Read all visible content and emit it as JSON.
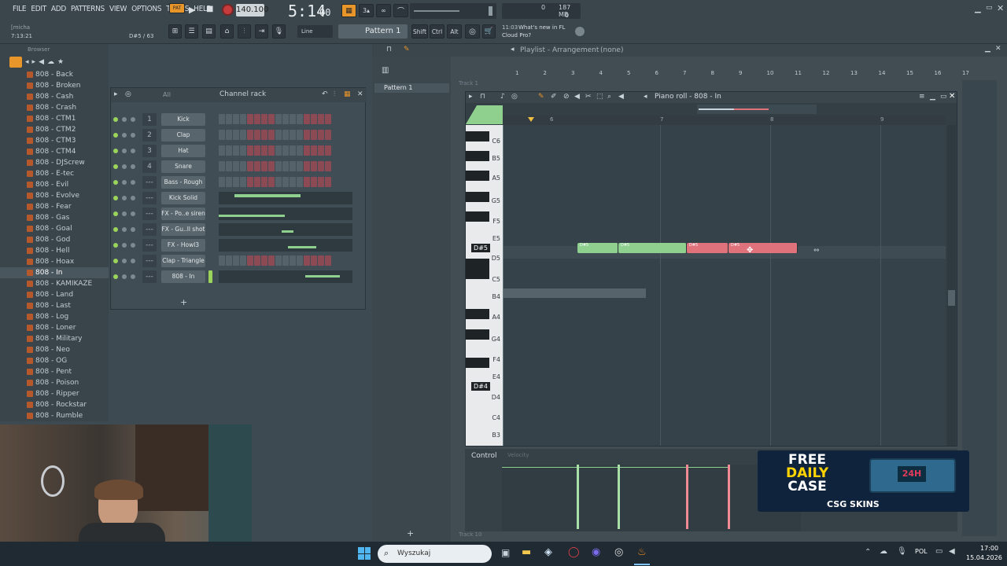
{
  "menu": [
    "FILE",
    "EDIT",
    "ADD",
    "PATTERNS",
    "VIEW",
    "OPTIONS",
    "TOOLS",
    "HELP"
  ],
  "transport": {
    "pat_label": "PAT",
    "tempo": "140.100",
    "time": "5:14",
    "time_ms": "00",
    "time_small": "M:S:CS",
    "cpu": "0",
    "mem": "187 MB",
    "poly": "0"
  },
  "hint": {
    "user": "[micha",
    "elapsed": "7:13:21",
    "note_info": "D#5 / 63"
  },
  "toolbar": {
    "snap": "Line",
    "pattern": "Pattern 1",
    "shift": "Shift",
    "ctrl": "Ctrl",
    "alt": "Alt"
  },
  "news": {
    "time": "11:03",
    "line1": "What's new in FL",
    "line2": "Cloud Pro?"
  },
  "browser": {
    "title": "Browser",
    "items": [
      "808 - Back",
      "808 - Broken",
      "808 - Cash",
      "808 - Crash",
      "808 - CTM1",
      "808 - CTM2",
      "808 - CTM3",
      "808 - CTM4",
      "808 - DJScrew",
      "808 - E-tec",
      "808 - Evil",
      "808 - Evolve",
      "808 - Fear",
      "808 - Gas",
      "808 - Goal",
      "808 - God",
      "808 - Hell",
      "808 - Hoax",
      "808 - In",
      "808 - KAMIKAZE",
      "808 - Land",
      "808 - Last",
      "808 - Log",
      "808 - Loner",
      "808 - Military",
      "808 - Neo",
      "808 - OG",
      "808 - Pent",
      "808 - Poison",
      "808 - Ripper",
      "808 - Rockstar",
      "808 - Rumble"
    ],
    "selected_index": 18
  },
  "channel_rack": {
    "title": "Channel rack",
    "filter": "All",
    "channels": [
      {
        "num": "1",
        "name": "Kick",
        "type": "steps"
      },
      {
        "num": "2",
        "name": "Clap",
        "type": "steps"
      },
      {
        "num": "3",
        "name": "Hat",
        "type": "steps"
      },
      {
        "num": "4",
        "name": "Snare",
        "type": "steps"
      },
      {
        "num": "---",
        "name": "Bass - Rough",
        "type": "steps"
      },
      {
        "num": "---",
        "name": "Kick Solid",
        "type": "roll"
      },
      {
        "num": "---",
        "name": "FX - Po..e siren",
        "type": "roll"
      },
      {
        "num": "---",
        "name": "FX - Gu..ll shot",
        "type": "roll"
      },
      {
        "num": "---",
        "name": "FX - Howl3",
        "type": "roll"
      },
      {
        "num": "---",
        "name": "Clap - Triangle",
        "type": "steps"
      },
      {
        "num": "---",
        "name": "808 - In",
        "type": "roll"
      }
    ],
    "add": "+"
  },
  "playlist": {
    "title": "Playlist - Arrangement",
    "sub": "(none)",
    "pattern_item": "Pattern 1",
    "track1": "Track 1",
    "track10": "Track 10",
    "bars": [
      "1",
      "2",
      "3",
      "4",
      "5",
      "6",
      "7",
      "8",
      "9",
      "10",
      "11",
      "12",
      "13",
      "14",
      "15",
      "16",
      "17"
    ]
  },
  "piano_roll": {
    "title": "Piano roll - 808 - In",
    "bars": [
      "6",
      "7",
      "8",
      "9"
    ],
    "keys": [
      "C6",
      "B5",
      "A5",
      "G5",
      "F5",
      "E5",
      "D#5",
      "D5",
      "C5",
      "B4",
      "A4",
      "G4",
      "F4",
      "E4",
      "D#4",
      "D4",
      "C4",
      "B3"
    ],
    "note_label": "D#5",
    "control_label": "Control",
    "control_sub": "Velocity"
  },
  "ad": {
    "line1": "FREE",
    "line2": "DAILY",
    "line3": "CASE",
    "brand": "CSG SKINS",
    "badge": "24H"
  },
  "taskbar": {
    "search": "Wyszukaj",
    "lang": "POL",
    "time": "17:00",
    "date": "15.04.2026"
  },
  "colors": {
    "note_green": "#8fd08f",
    "note_red": "#e0727c",
    "accent_orange": "#e8952a",
    "bg": "#3d4a52"
  }
}
